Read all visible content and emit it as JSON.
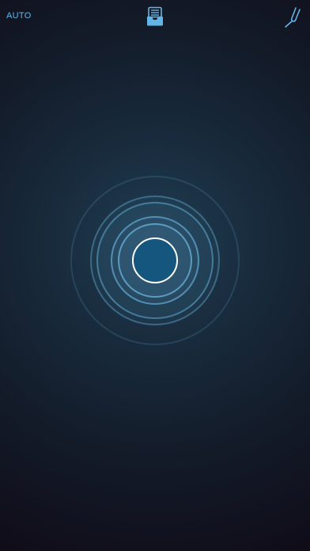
{
  "header": {
    "mode_label": "AUTO",
    "center_icon": "history-tray-icon",
    "right_icon": "tuning-fork-icon"
  },
  "main": {
    "center_control": "record-button"
  },
  "colors": {
    "accent": "#62b6e7",
    "button_fill": "#15567f",
    "background_top": "#1f3d52",
    "background_bottom": "#100c18"
  }
}
